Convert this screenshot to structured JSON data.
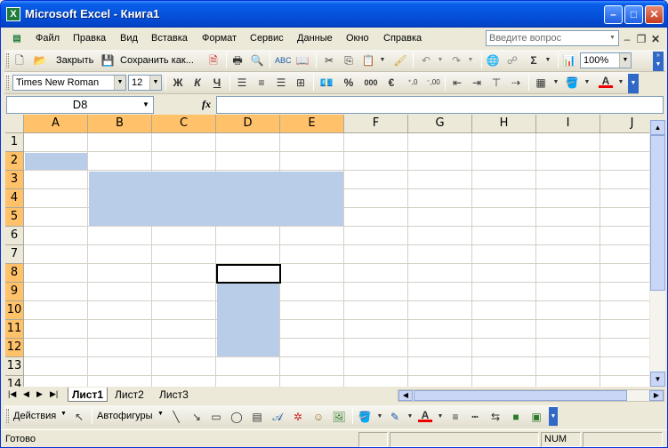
{
  "window": {
    "title": "Microsoft Excel - Книга1",
    "app_icon": "X",
    "minimize": "–",
    "maximize": "□",
    "close": "✕"
  },
  "menu": {
    "items": [
      "Файл",
      "Правка",
      "Вид",
      "Вставка",
      "Формат",
      "Сервис",
      "Данные",
      "Окно",
      "Справка"
    ],
    "question_placeholder": "Введите вопрос"
  },
  "standard_toolbar": {
    "close_label": "Закрыть",
    "save_as_label": "Сохранить как...",
    "zoom": "100%"
  },
  "format_toolbar": {
    "font": "Times New Roman",
    "size": "12",
    "bold": "Ж",
    "italic": "К",
    "underline": "Ч",
    "percent": "%",
    "thousands": "000",
    "euro": "€",
    "inc_decimal": ",00→,0",
    "dec_decimal": ",0→,00"
  },
  "formula_bar": {
    "name_box": "D8",
    "fx": "fx",
    "value": ""
  },
  "sheet": {
    "columns": [
      "A",
      "B",
      "C",
      "D",
      "E",
      "F",
      "G",
      "H",
      "I",
      "J"
    ],
    "selected_columns": [
      "A",
      "B",
      "C",
      "D",
      "E"
    ],
    "rows": [
      "1",
      "2",
      "3",
      "4",
      "5",
      "6",
      "7",
      "8",
      "9",
      "10",
      "11",
      "12",
      "13",
      "14"
    ],
    "selected_rows": [
      "2",
      "3",
      "4",
      "5",
      "8",
      "9",
      "10",
      "11",
      "12"
    ],
    "active_cell": "D8",
    "selected_ranges": [
      "A2",
      "B3:E5",
      "D8:D12"
    ],
    "selection_color": "#bacde8",
    "header_highlight_color": "#ffc169"
  },
  "sheet_tabs": {
    "tabs": [
      "Лист1",
      "Лист2",
      "Лист3"
    ],
    "active": "Лист1"
  },
  "drawing_toolbar": {
    "actions_label": "Действия",
    "autoshapes_label": "Автофигуры"
  },
  "status": {
    "ready": "Готово",
    "num": "NUM"
  }
}
